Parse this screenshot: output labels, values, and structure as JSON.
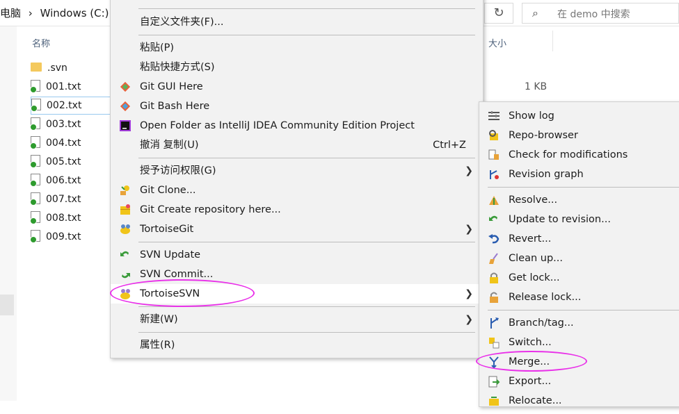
{
  "addressbar": {
    "path_parts": [
      "电脑",
      "Windows (C:)"
    ],
    "refresh_glyph": "↻",
    "search_placeholder": "在 demo 中搜索"
  },
  "columns": {
    "name": "名称",
    "size": "大小"
  },
  "files": [
    {
      "name": ".svn",
      "type": "folder"
    },
    {
      "name": "001.txt",
      "type": "file",
      "size": "1 KB"
    },
    {
      "name": "002.txt",
      "type": "file"
    },
    {
      "name": "003.txt",
      "type": "file"
    },
    {
      "name": "004.txt",
      "type": "file"
    },
    {
      "name": "005.txt",
      "type": "file"
    },
    {
      "name": "006.txt",
      "type": "file"
    },
    {
      "name": "007.txt",
      "type": "file"
    },
    {
      "name": "008.txt",
      "type": "file"
    },
    {
      "name": "009.txt",
      "type": "file"
    }
  ],
  "main_menu": {
    "items": [
      {
        "label": "自定义文件夹(F)..."
      },
      {
        "label": "粘贴(P)"
      },
      {
        "label": "粘贴快捷方式(S)"
      },
      {
        "label": "Git GUI Here",
        "icon": "git-gui-icon"
      },
      {
        "label": "Git Bash Here",
        "icon": "git-bash-icon"
      },
      {
        "label": "Open Folder as IntelliJ IDEA Community Edition Project",
        "icon": "intellij-icon"
      },
      {
        "label": "撤消 复制(U)",
        "shortcut": "Ctrl+Z"
      },
      {
        "label": "授予访问权限(G)",
        "submenu": true
      },
      {
        "label": "Git Clone...",
        "icon": "git-clone-icon"
      },
      {
        "label": "Git Create repository here...",
        "icon": "git-create-repo-icon"
      },
      {
        "label": "TortoiseGit",
        "icon": "tortoisegit-icon",
        "submenu": true
      },
      {
        "label": "SVN Update",
        "icon": "svn-update-icon"
      },
      {
        "label": "SVN Commit...",
        "icon": "svn-commit-icon"
      },
      {
        "label": "TortoiseSVN",
        "icon": "tortoisesvn-icon",
        "submenu": true
      },
      {
        "label": "新建(W)",
        "submenu": true
      },
      {
        "label": "属性(R)"
      }
    ]
  },
  "svn_menu": {
    "items": [
      {
        "label": "Show log",
        "icon": "show-log-icon"
      },
      {
        "label": "Repo-browser",
        "icon": "repo-browser-icon"
      },
      {
        "label": "Check for modifications",
        "icon": "check-modifications-icon"
      },
      {
        "label": "Revision graph",
        "icon": "revision-graph-icon"
      },
      {
        "label": "Resolve...",
        "icon": "resolve-icon"
      },
      {
        "label": "Update to revision...",
        "icon": "update-revision-icon"
      },
      {
        "label": "Revert...",
        "icon": "revert-icon"
      },
      {
        "label": "Clean up...",
        "icon": "cleanup-icon"
      },
      {
        "label": "Get lock...",
        "icon": "lock-icon"
      },
      {
        "label": "Release lock...",
        "icon": "unlock-icon"
      },
      {
        "label": "Branch/tag...",
        "icon": "branch-icon"
      },
      {
        "label": "Switch...",
        "icon": "switch-icon"
      },
      {
        "label": "Merge...",
        "icon": "merge-icon"
      },
      {
        "label": "Export...",
        "icon": "export-icon"
      },
      {
        "label": "Relocate...",
        "icon": "relocate-icon"
      }
    ]
  },
  "colors": {
    "highlight_ellipse": "#e930e9",
    "menu_bg": "#f2f2f2"
  }
}
